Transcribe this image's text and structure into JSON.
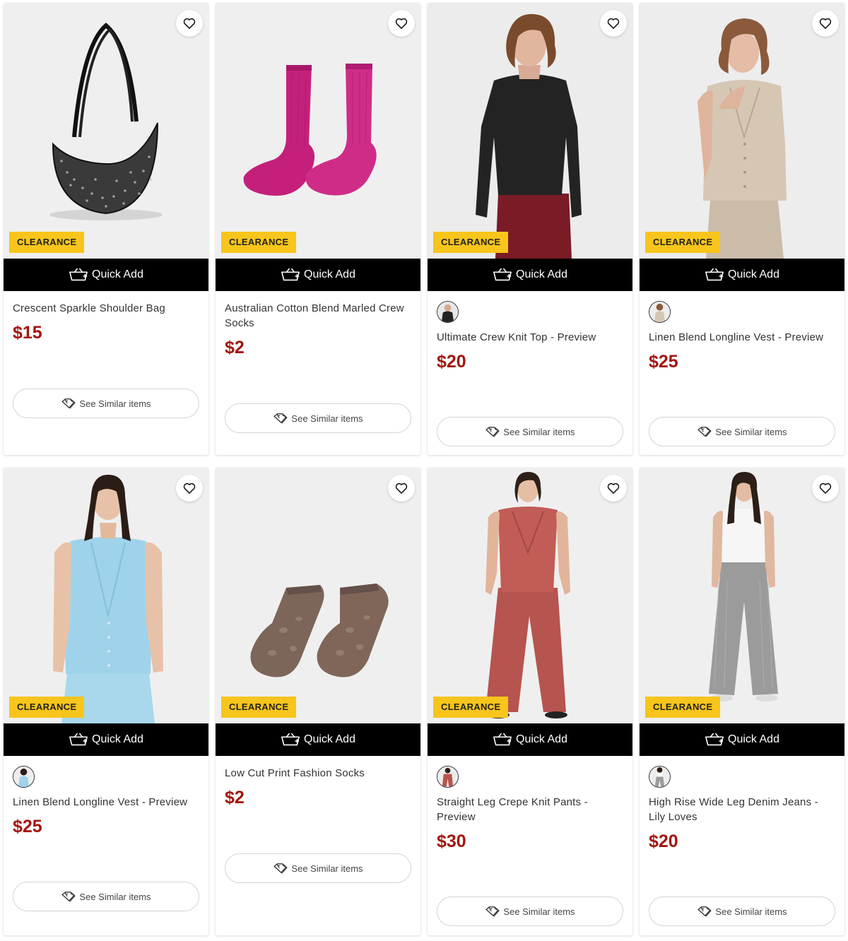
{
  "colors": {
    "clearance_badge": "#f7c51b",
    "quick_add_bg": "#000000",
    "price": "#a3150f"
  },
  "icons": {
    "wishlist": "heart-icon",
    "quick_add": "basket-icon",
    "see_similar": "tag-icon"
  },
  "products": [
    {
      "name": "Crescent Sparkle Shoulder Bag",
      "price": "$15",
      "badge": "CLEARANCE",
      "quick_add": "Quick Add",
      "similar": "See Similar items",
      "has_swatch": false
    },
    {
      "name": "Australian Cotton Blend Marled Crew Socks",
      "price": "$2",
      "badge": "CLEARANCE",
      "quick_add": "Quick Add",
      "similar": "See Similar items",
      "has_swatch": false
    },
    {
      "name": "Ultimate Crew Knit Top - Preview",
      "price": "$20",
      "badge": "CLEARANCE",
      "quick_add": "Quick Add",
      "similar": "See Similar items",
      "has_swatch": true
    },
    {
      "name": "Linen Blend Longline Vest - Preview",
      "price": "$25",
      "badge": "CLEARANCE",
      "quick_add": "Quick Add",
      "similar": "See Similar items",
      "has_swatch": true
    },
    {
      "name": "Linen Blend Longline Vest - Preview",
      "price": "$25",
      "badge": "CLEARANCE",
      "quick_add": "Quick Add",
      "similar": "See Similar items",
      "has_swatch": true
    },
    {
      "name": "Low Cut Print Fashion Socks",
      "price": "$2",
      "badge": "CLEARANCE",
      "quick_add": "Quick Add",
      "similar": "See Similar items",
      "has_swatch": false
    },
    {
      "name": "Straight Leg Crepe Knit Pants - Preview",
      "price": "$30",
      "badge": "CLEARANCE",
      "quick_add": "Quick Add",
      "similar": "See Similar items",
      "has_swatch": true
    },
    {
      "name": "High Rise Wide Leg Denim Jeans - Lily Loves",
      "price": "$20",
      "badge": "CLEARANCE",
      "quick_add": "Quick Add",
      "similar": "See Similar items",
      "has_swatch": true
    }
  ]
}
